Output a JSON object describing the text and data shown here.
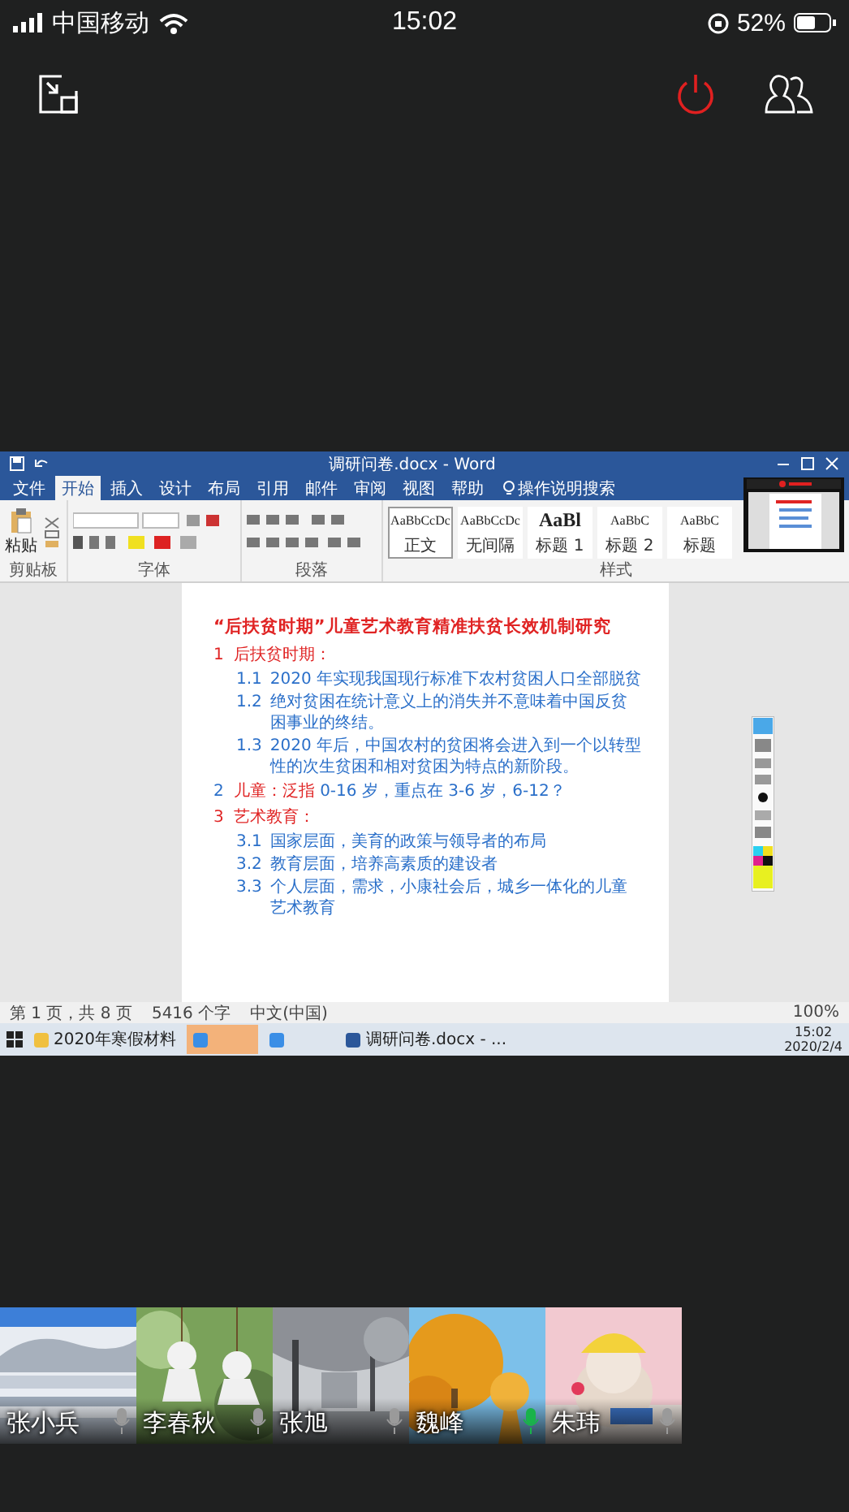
{
  "status_bar": {
    "carrier": "中国移动",
    "time": "15:02",
    "battery": "52%"
  },
  "shared_screen": {
    "window_title": "调研问卷.docx - Word",
    "ribbon_tabs": [
      {
        "label": "文件",
        "selected": false
      },
      {
        "label": "开始",
        "selected": true
      },
      {
        "label": "插入",
        "selected": false
      },
      {
        "label": "设计",
        "selected": false
      },
      {
        "label": "布局",
        "selected": false
      },
      {
        "label": "引用",
        "selected": false
      },
      {
        "label": "邮件",
        "selected": false
      },
      {
        "label": "审阅",
        "selected": false
      },
      {
        "label": "视图",
        "selected": false
      },
      {
        "label": "帮助",
        "selected": false
      }
    ],
    "search_hint": "操作说明搜索",
    "paste_label": "粘贴",
    "groups": [
      "剪贴板",
      "字体",
      "段落",
      "样式"
    ],
    "styles": [
      {
        "sample": "AaBbCcDc",
        "label": "正文",
        "selected": true
      },
      {
        "sample": "AaBbCcDc",
        "label": "无间隔",
        "selected": false
      },
      {
        "sample": "AaBl",
        "label": "标题 1",
        "selected": false
      },
      {
        "sample": "AaBbC",
        "label": "标题 2",
        "selected": false
      },
      {
        "sample": "AaBbC",
        "label": "标题",
        "selected": false
      }
    ],
    "document": {
      "title": "“后扶贫时期”儿童艺术教育精准扶贫长效机制研究",
      "sections": [
        {
          "number": "1",
          "color": "#e02424",
          "label": "后扶贫时期：",
          "children": [
            {
              "number": "1.1",
              "text": "2020 年实现我国现行标准下农村贫困人口全部脱贫"
            },
            {
              "number": "1.2",
              "text": "绝对贫困在统计意义上的消失并不意味着中国反贫困事业的终结。"
            },
            {
              "number": "1.3",
              "text": "2020 年后，中国农村的贫困将会进入到一个以转型性的次生贫困和相对贫困为特点的新阶段。"
            }
          ]
        },
        {
          "number": "2",
          "color": "#2a6fc9",
          "label": "儿童：泛指",
          "text": "0-16 岁，重点在 3-6 岁，6-12？"
        },
        {
          "number": "3",
          "color": "#e02424",
          "label": "艺术教育：",
          "children": [
            {
              "number": "3.1",
              "text": "国家层面，美育的政策与领导者的布局"
            },
            {
              "number": "3.2",
              "text": "教育层面，培养高素质的建设者"
            },
            {
              "number": "3.3",
              "text": "个人层面，需求，小康社会后，城乡一体化的儿童艺术教育"
            }
          ]
        }
      ]
    },
    "doc_status": [
      "第 1 页，共 8 页",
      "5416 个字",
      "中文(中国)"
    ],
    "zoom": "100%",
    "taskbar": {
      "items": [
        {
          "label": "2020年寒假材料",
          "selected": false
        },
        {
          "selected": true
        },
        {
          "selected": false
        },
        {
          "label": "调研问卷.docx - ...",
          "selected": false
        }
      ],
      "time": "15:02",
      "date": "2020/2/4"
    }
  },
  "participants": [
    {
      "name": "张小兵",
      "speaking": false
    },
    {
      "name": "李春秋",
      "speaking": false
    },
    {
      "name": "张旭",
      "speaking": false
    },
    {
      "name": "魏峰",
      "speaking": true
    },
    {
      "name": "朱玮",
      "speaking": false
    }
  ]
}
